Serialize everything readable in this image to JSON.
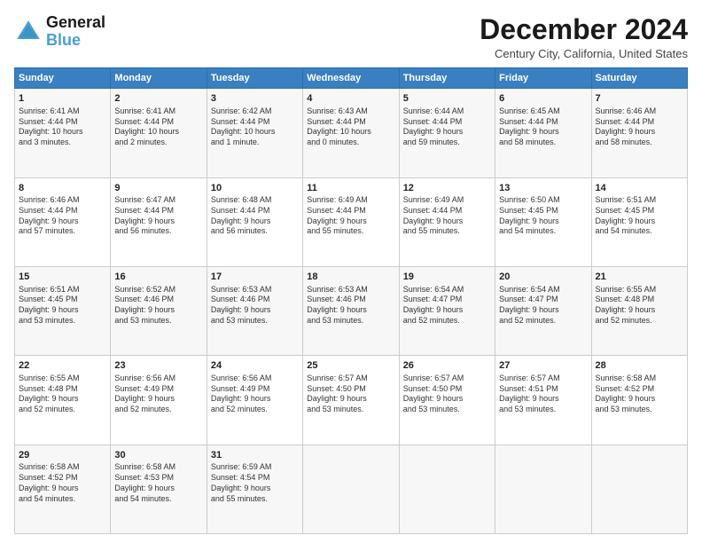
{
  "logo": {
    "line1": "General",
    "line2": "Blue"
  },
  "title": "December 2024",
  "subtitle": "Century City, California, United States",
  "days_header": [
    "Sunday",
    "Monday",
    "Tuesday",
    "Wednesday",
    "Thursday",
    "Friday",
    "Saturday"
  ],
  "weeks": [
    [
      {
        "day": "1",
        "detail": "Sunrise: 6:41 AM\nSunset: 4:44 PM\nDaylight: 10 hours\nand 3 minutes."
      },
      {
        "day": "2",
        "detail": "Sunrise: 6:41 AM\nSunset: 4:44 PM\nDaylight: 10 hours\nand 2 minutes."
      },
      {
        "day": "3",
        "detail": "Sunrise: 6:42 AM\nSunset: 4:44 PM\nDaylight: 10 hours\nand 1 minute."
      },
      {
        "day": "4",
        "detail": "Sunrise: 6:43 AM\nSunset: 4:44 PM\nDaylight: 10 hours\nand 0 minutes."
      },
      {
        "day": "5",
        "detail": "Sunrise: 6:44 AM\nSunset: 4:44 PM\nDaylight: 9 hours\nand 59 minutes."
      },
      {
        "day": "6",
        "detail": "Sunrise: 6:45 AM\nSunset: 4:44 PM\nDaylight: 9 hours\nand 58 minutes."
      },
      {
        "day": "7",
        "detail": "Sunrise: 6:46 AM\nSunset: 4:44 PM\nDaylight: 9 hours\nand 58 minutes."
      }
    ],
    [
      {
        "day": "8",
        "detail": "Sunrise: 6:46 AM\nSunset: 4:44 PM\nDaylight: 9 hours\nand 57 minutes."
      },
      {
        "day": "9",
        "detail": "Sunrise: 6:47 AM\nSunset: 4:44 PM\nDaylight: 9 hours\nand 56 minutes."
      },
      {
        "day": "10",
        "detail": "Sunrise: 6:48 AM\nSunset: 4:44 PM\nDaylight: 9 hours\nand 56 minutes."
      },
      {
        "day": "11",
        "detail": "Sunrise: 6:49 AM\nSunset: 4:44 PM\nDaylight: 9 hours\nand 55 minutes."
      },
      {
        "day": "12",
        "detail": "Sunrise: 6:49 AM\nSunset: 4:44 PM\nDaylight: 9 hours\nand 55 minutes."
      },
      {
        "day": "13",
        "detail": "Sunrise: 6:50 AM\nSunset: 4:45 PM\nDaylight: 9 hours\nand 54 minutes."
      },
      {
        "day": "14",
        "detail": "Sunrise: 6:51 AM\nSunset: 4:45 PM\nDaylight: 9 hours\nand 54 minutes."
      }
    ],
    [
      {
        "day": "15",
        "detail": "Sunrise: 6:51 AM\nSunset: 4:45 PM\nDaylight: 9 hours\nand 53 minutes."
      },
      {
        "day": "16",
        "detail": "Sunrise: 6:52 AM\nSunset: 4:46 PM\nDaylight: 9 hours\nand 53 minutes."
      },
      {
        "day": "17",
        "detail": "Sunrise: 6:53 AM\nSunset: 4:46 PM\nDaylight: 9 hours\nand 53 minutes."
      },
      {
        "day": "18",
        "detail": "Sunrise: 6:53 AM\nSunset: 4:46 PM\nDaylight: 9 hours\nand 53 minutes."
      },
      {
        "day": "19",
        "detail": "Sunrise: 6:54 AM\nSunset: 4:47 PM\nDaylight: 9 hours\nand 52 minutes."
      },
      {
        "day": "20",
        "detail": "Sunrise: 6:54 AM\nSunset: 4:47 PM\nDaylight: 9 hours\nand 52 minutes."
      },
      {
        "day": "21",
        "detail": "Sunrise: 6:55 AM\nSunset: 4:48 PM\nDaylight: 9 hours\nand 52 minutes."
      }
    ],
    [
      {
        "day": "22",
        "detail": "Sunrise: 6:55 AM\nSunset: 4:48 PM\nDaylight: 9 hours\nand 52 minutes."
      },
      {
        "day": "23",
        "detail": "Sunrise: 6:56 AM\nSunset: 4:49 PM\nDaylight: 9 hours\nand 52 minutes."
      },
      {
        "day": "24",
        "detail": "Sunrise: 6:56 AM\nSunset: 4:49 PM\nDaylight: 9 hours\nand 52 minutes."
      },
      {
        "day": "25",
        "detail": "Sunrise: 6:57 AM\nSunset: 4:50 PM\nDaylight: 9 hours\nand 53 minutes."
      },
      {
        "day": "26",
        "detail": "Sunrise: 6:57 AM\nSunset: 4:50 PM\nDaylight: 9 hours\nand 53 minutes."
      },
      {
        "day": "27",
        "detail": "Sunrise: 6:57 AM\nSunset: 4:51 PM\nDaylight: 9 hours\nand 53 minutes."
      },
      {
        "day": "28",
        "detail": "Sunrise: 6:58 AM\nSunset: 4:52 PM\nDaylight: 9 hours\nand 53 minutes."
      }
    ],
    [
      {
        "day": "29",
        "detail": "Sunrise: 6:58 AM\nSunset: 4:52 PM\nDaylight: 9 hours\nand 54 minutes."
      },
      {
        "day": "30",
        "detail": "Sunrise: 6:58 AM\nSunset: 4:53 PM\nDaylight: 9 hours\nand 54 minutes."
      },
      {
        "day": "31",
        "detail": "Sunrise: 6:59 AM\nSunset: 4:54 PM\nDaylight: 9 hours\nand 55 minutes."
      },
      null,
      null,
      null,
      null
    ]
  ]
}
